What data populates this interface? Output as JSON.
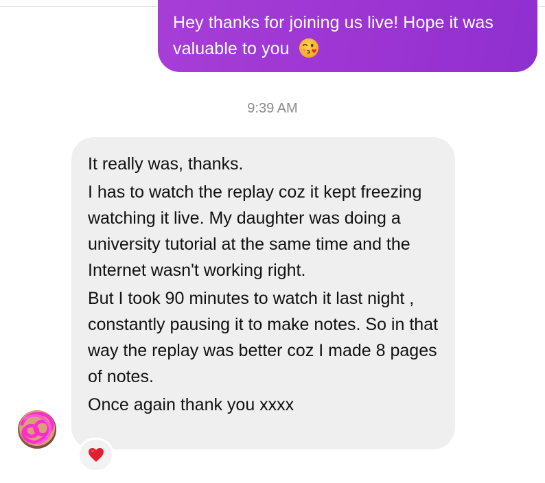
{
  "outgoing_message": {
    "text": "Hey thanks for joining us live! Hope it was valuable to you",
    "emoji": "face-blowing-kiss",
    "bubble_color": "#9b34d2"
  },
  "timestamp": "9:39 AM",
  "incoming_message": {
    "paragraphs": [
      "It really was, thanks.",
      "I has to watch the replay coz it kept freezing watching it live. My daughter was doing a university tutorial at the same time and the Internet wasn't working right.",
      "But I took 90 minutes to watch it last night , constantly pausing it to make notes. So in that way the replay was better coz I made 8 pages of notes.",
      "Once again thank you xxxx"
    ],
    "bubble_color": "#efeff0"
  },
  "avatar": {
    "icon": "contact-avatar",
    "obscured": true
  },
  "reaction": {
    "icon": "red-heart",
    "color": "#e0202f"
  }
}
